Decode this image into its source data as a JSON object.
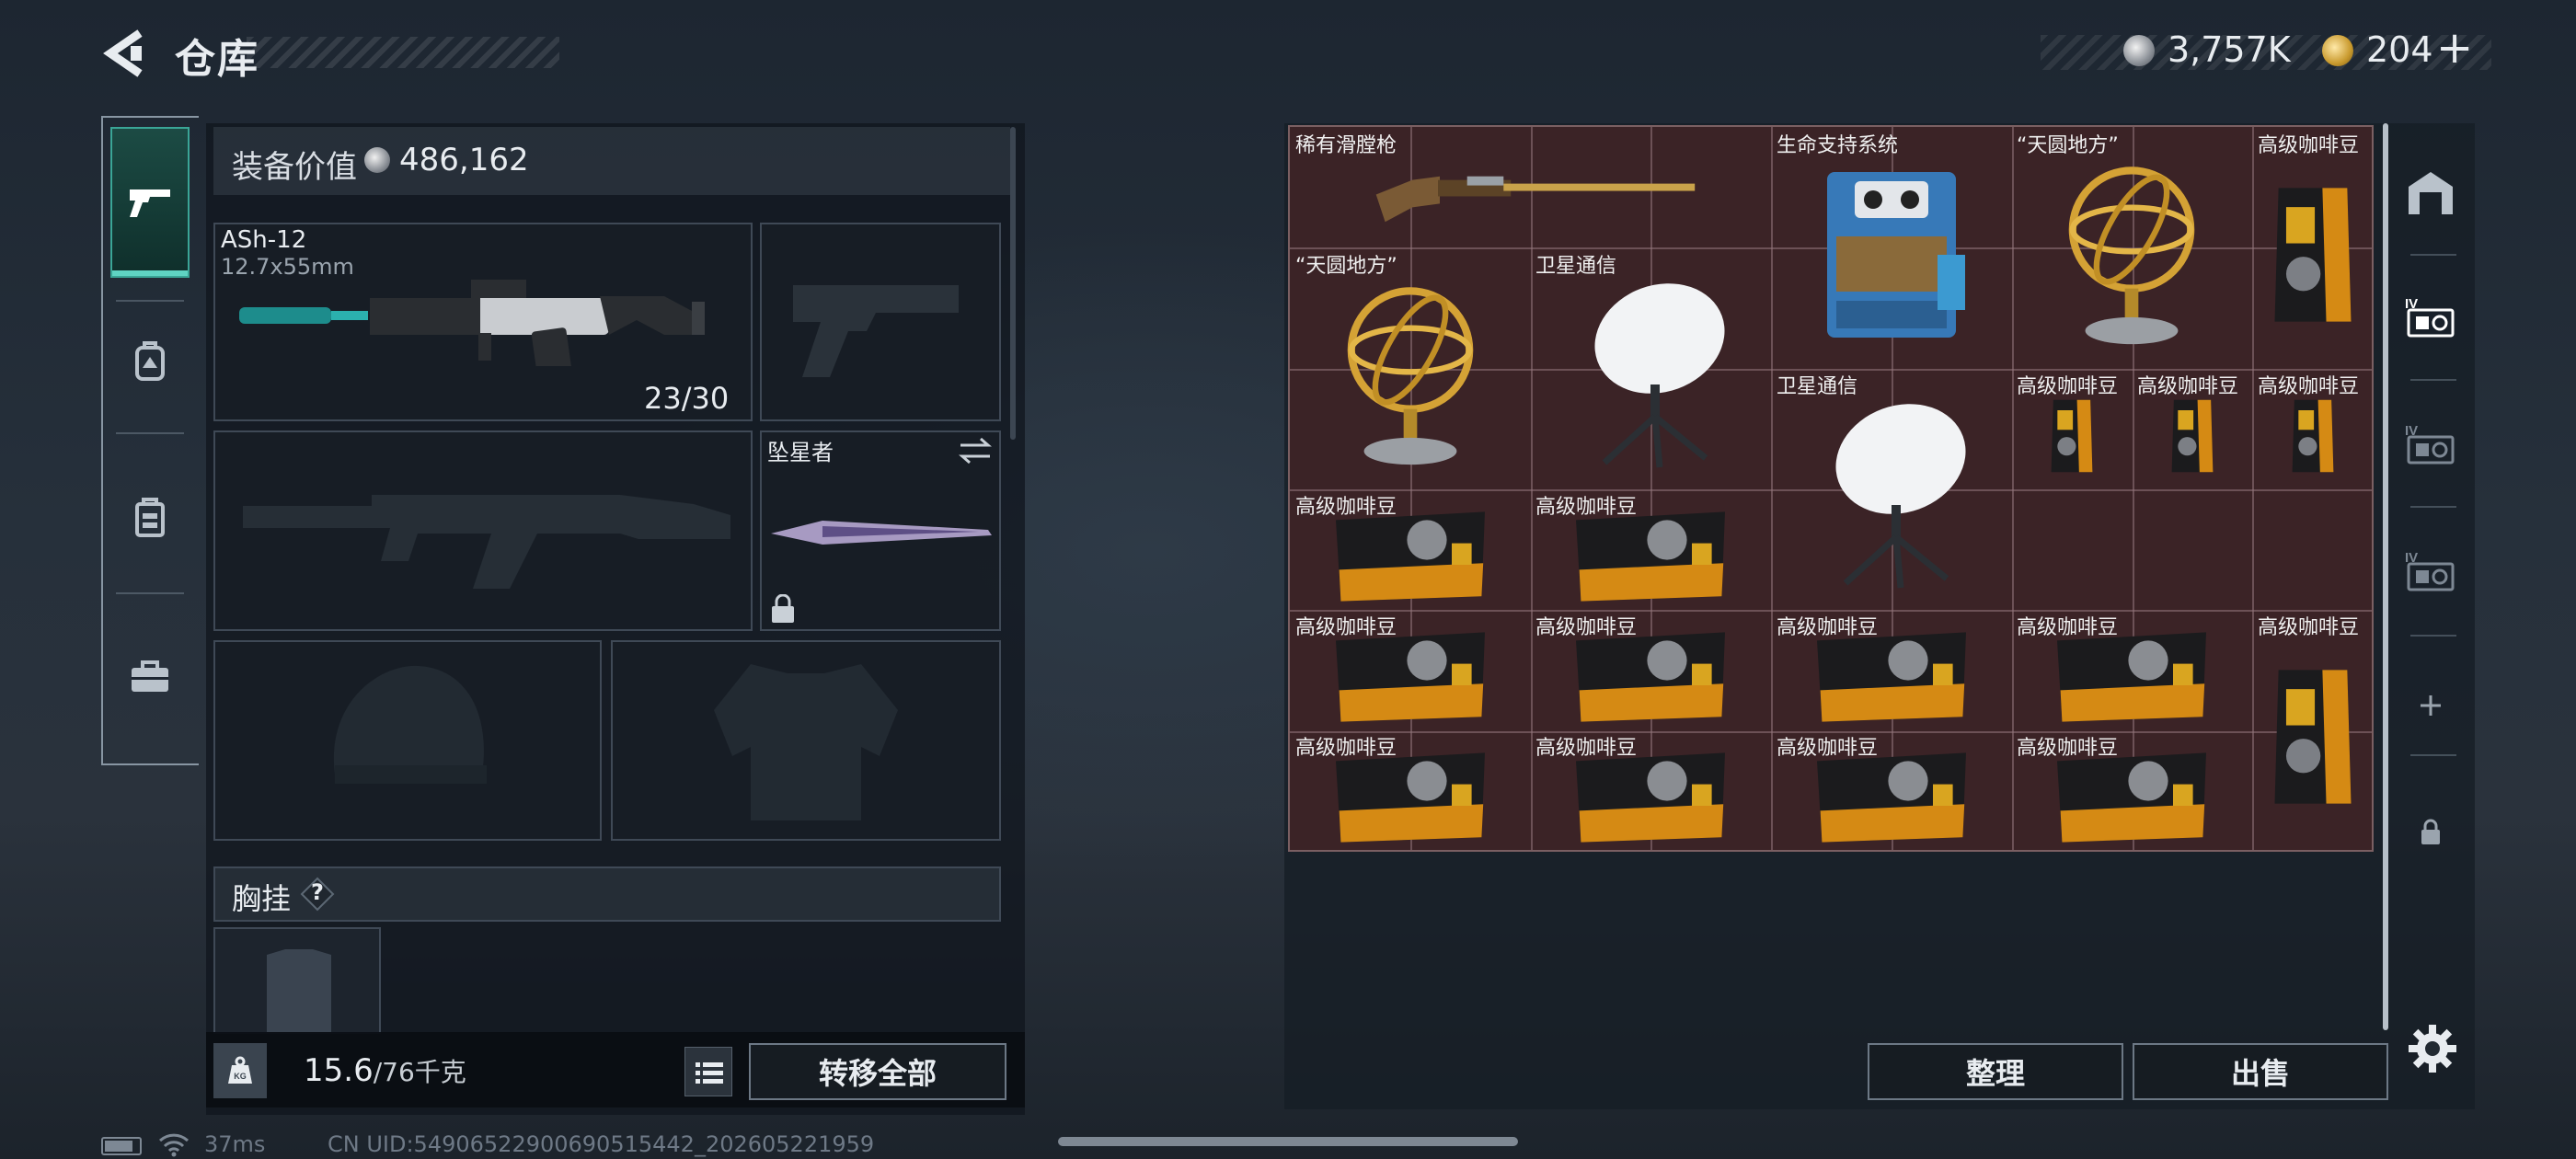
{
  "header": {
    "title": "仓库",
    "currency_silver": "3,757K",
    "currency_gold": "204",
    "add_label": "+"
  },
  "loadout": {
    "value_label": "装备价值",
    "value": "486,162",
    "primary_weapon": {
      "name": "ASh-12",
      "caliber": "12.7x55mm",
      "ammo": "23/30"
    },
    "melee": {
      "name": "坠星者"
    },
    "chest_rig_label": "胸挂",
    "help_icon": "?",
    "weight_current": "15.6",
    "weight_max": "/76千克",
    "transfer_all_label": "转移全部"
  },
  "stash": {
    "items": [
      {
        "label": "稀有滑膛枪",
        "icon": "musket-icon"
      },
      {
        "label": "生命支持系统",
        "icon": "life-support-icon"
      },
      {
        "label": "“天圆地方”",
        "icon": "armillary-sphere-icon"
      },
      {
        "label": "高级咖啡豆",
        "icon": "coffee-bag-icon"
      },
      {
        "label": "“天圆地方”",
        "icon": "armillary-sphere-icon"
      },
      {
        "label": "卫星通信",
        "icon": "satellite-dish-icon"
      },
      {
        "label": "卫星通信",
        "icon": "satellite-dish-icon"
      },
      {
        "label": "高级咖啡豆",
        "icon": "coffee-bag-icon"
      },
      {
        "label": "高级咖啡豆",
        "icon": "coffee-bag-icon"
      },
      {
        "label": "高级咖啡豆",
        "icon": "coffee-bag-icon"
      },
      {
        "label": "高级咖啡豆",
        "icon": "coffee-bag-icon"
      },
      {
        "label": "高级咖啡豆",
        "icon": "coffee-bag-icon"
      },
      {
        "label": "高级咖啡豆",
        "icon": "coffee-bag-icon"
      },
      {
        "label": "高级咖啡豆",
        "icon": "coffee-bag-icon"
      },
      {
        "label": "高级咖啡豆",
        "icon": "coffee-bag-icon"
      },
      {
        "label": "高级咖啡豆",
        "icon": "coffee-bag-icon"
      },
      {
        "label": "高级咖啡豆",
        "icon": "coffee-bag-icon"
      },
      {
        "label": "高级咖啡豆",
        "icon": "coffee-bag-icon"
      },
      {
        "label": "高级咖啡豆",
        "icon": "coffee-bag-icon"
      },
      {
        "label": "高级咖啡豆",
        "icon": "coffee-bag-icon"
      },
      {
        "label": "高级咖啡豆",
        "icon": "coffee-bag-icon"
      }
    ],
    "sort_label": "整理",
    "sell_label": "出售"
  },
  "status_bar": {
    "ping": "37ms",
    "uid": "CN UID:5490652290069051544​2_202605221959"
  },
  "colors": {
    "accent": "#3aa596",
    "stash_bg": "#3b2326"
  }
}
